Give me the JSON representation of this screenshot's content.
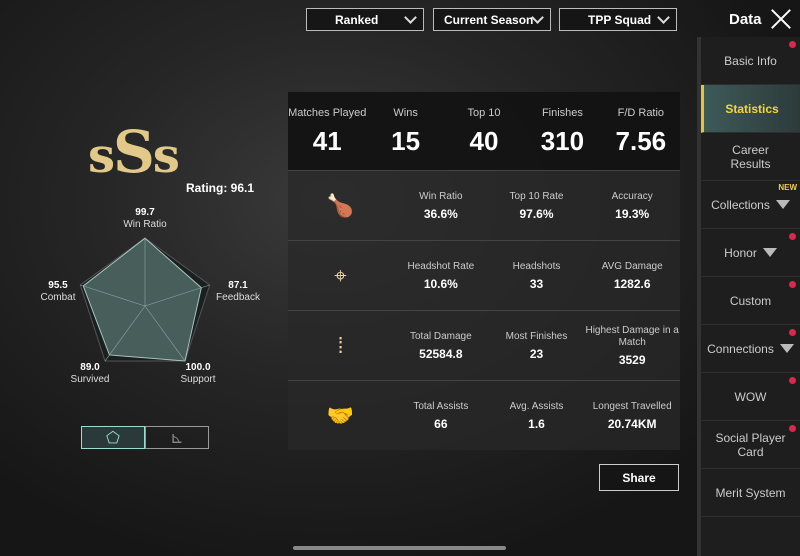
{
  "header": {
    "filters": [
      "Ranked",
      "Current Season",
      "TPP Squad"
    ],
    "title": "Data"
  },
  "sidebar": {
    "items": [
      {
        "label": "Basic Info",
        "dot": true
      },
      {
        "label": "Statistics",
        "active": true
      },
      {
        "label": "Career Results"
      },
      {
        "label": "Collections",
        "badge": "NEW",
        "dropdown": true
      },
      {
        "label": "Honor",
        "dot": true,
        "dropdown": true
      },
      {
        "label": "Custom",
        "dot": true
      },
      {
        "label": "Connections",
        "dot": true,
        "dropdown": true
      },
      {
        "label": "WOW",
        "dot": true
      },
      {
        "label": "Social Player Card",
        "dot": true
      },
      {
        "label": "Merit System"
      }
    ]
  },
  "rating": {
    "grade": "SSS",
    "label": "Rating: 96.1"
  },
  "radar": {
    "axes": [
      {
        "label": "Win Ratio",
        "value": "99.7"
      },
      {
        "label": "Feedback",
        "value": "87.1"
      },
      {
        "label": "Support",
        "value": "100.0"
      },
      {
        "label": "Survived",
        "value": "89.0"
      },
      {
        "label": "Combat",
        "value": "95.5"
      }
    ]
  },
  "summary": [
    {
      "label": "Matches Played",
      "value": "41"
    },
    {
      "label": "Wins",
      "value": "15"
    },
    {
      "label": "Top 10",
      "value": "40"
    },
    {
      "label": "Finishes",
      "value": "310"
    },
    {
      "label": "F/D Ratio",
      "value": "7.56"
    }
  ],
  "rows": [
    {
      "icon": "chicken-icon",
      "stats": [
        {
          "label": "Win Ratio",
          "value": "36.6%"
        },
        {
          "label": "Top 10 Rate",
          "value": "97.6%"
        },
        {
          "label": "Accuracy",
          "value": "19.3%"
        }
      ]
    },
    {
      "icon": "crosshair-icon",
      "stats": [
        {
          "label": "Headshot Rate",
          "value": "10.6%"
        },
        {
          "label": "Headshots",
          "value": "33"
        },
        {
          "label": "AVG Damage",
          "value": "1282.6"
        }
      ]
    },
    {
      "icon": "bullets-icon",
      "stats": [
        {
          "label": "Total Damage",
          "value": "52584.8"
        },
        {
          "label": "Most Finishes",
          "value": "23"
        },
        {
          "label": "Highest Damage in a Match",
          "value": "3529"
        }
      ]
    },
    {
      "icon": "handshake-icon",
      "stats": [
        {
          "label": "Total Assists",
          "value": "66"
        },
        {
          "label": "Avg. Assists",
          "value": "1.6"
        },
        {
          "label": "Longest Travelled",
          "value": "20.74KM"
        }
      ]
    }
  ],
  "share_label": "Share",
  "colors": {
    "accent": "#f5d63a",
    "notification": "#e0264a",
    "gold": "#e2c98a",
    "radar": "#9fdcd0"
  }
}
